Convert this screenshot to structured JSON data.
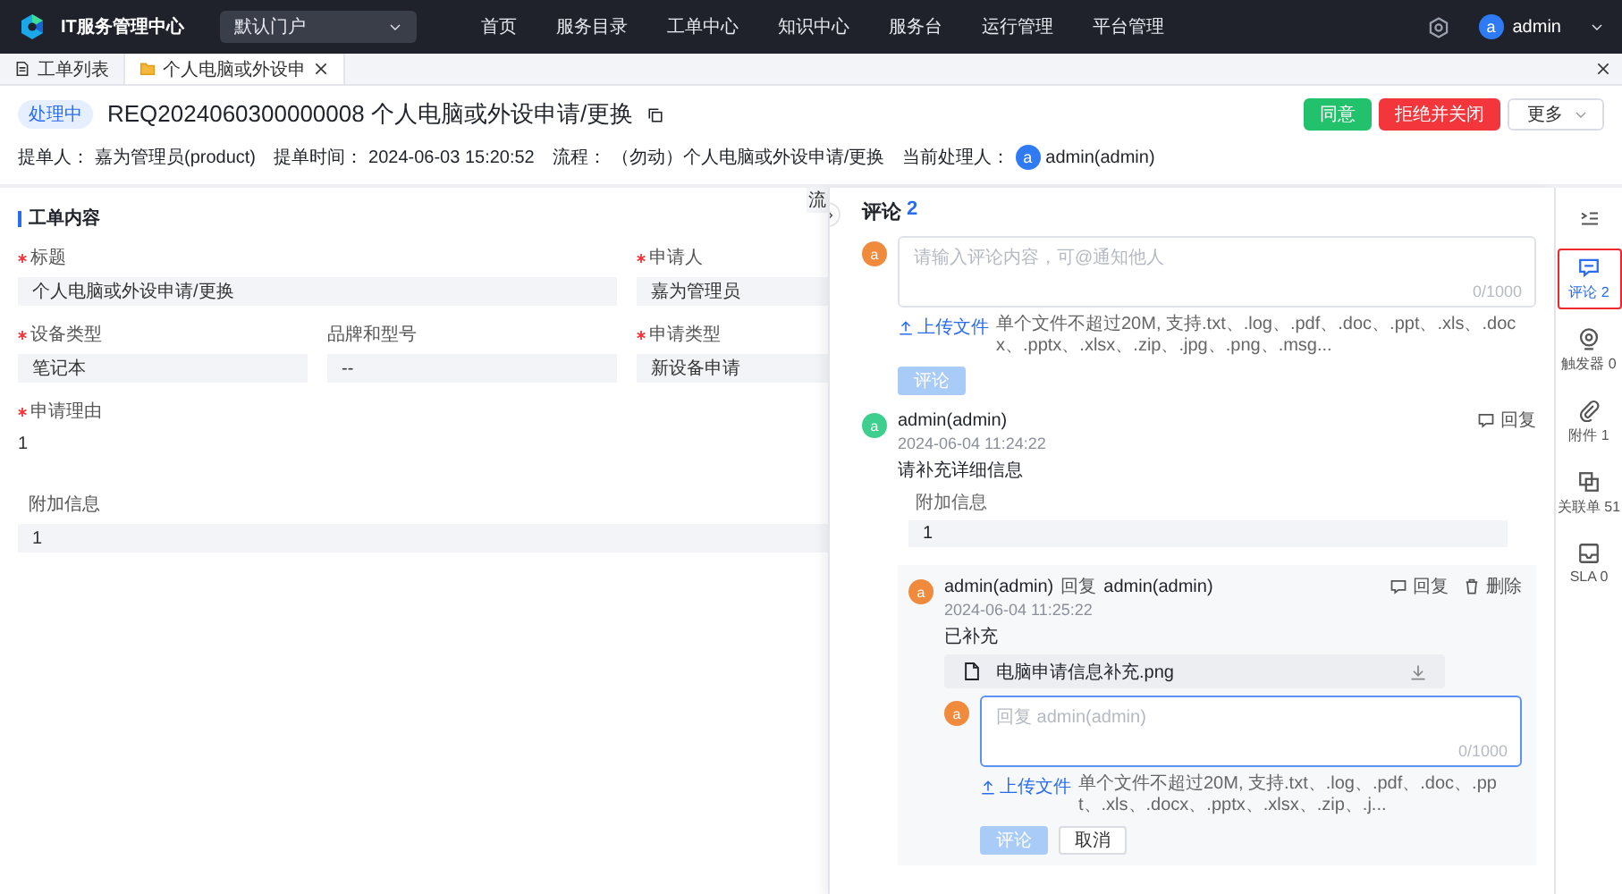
{
  "topbar": {
    "app_title": "IT服务管理中心",
    "portal_select": "默认门户",
    "menu": [
      "首页",
      "服务目录",
      "工单中心",
      "知识中心",
      "服务台",
      "运行管理",
      "平台管理"
    ],
    "user": {
      "avatar": "a",
      "name": "admin"
    }
  },
  "tabs": [
    {
      "label": "工单列表",
      "kind": "list",
      "selected": false,
      "closable": false
    },
    {
      "label": "个人电脑或外设申",
      "kind": "ticket",
      "selected": true,
      "closable": true
    }
  ],
  "ticket": {
    "status": "处理中",
    "title": "REQ2024060300000008 个人电脑或外设申请/更换",
    "actions": [
      {
        "label": "同意",
        "kind": "success"
      },
      {
        "label": "拒绝并关闭",
        "kind": "danger"
      },
      {
        "label": "更多",
        "kind": "dropdown"
      }
    ],
    "meta": [
      {
        "label": "提单人：",
        "value": "嘉为管理员(product)"
      },
      {
        "label": "提单时间：",
        "value": "2024-06-03 15:20:52"
      },
      {
        "label": "流程：",
        "value": "（勿动）个人电脑或外设申请/更换"
      },
      {
        "label": "当前处理人：",
        "value": "admin(admin)",
        "avatar": "a"
      }
    ]
  },
  "form": {
    "section_title": "工单内容",
    "side_tab_fragment": "流",
    "fields": [
      {
        "label": "标题",
        "required": true,
        "value": "个人电脑或外设申请/更换",
        "kind": "wide"
      },
      {
        "label": "申请人",
        "required": true,
        "value": "嘉为管理员",
        "kind": "box"
      },
      {
        "label": "设备类型",
        "required": true,
        "value": "笔记本",
        "kind": "box"
      },
      {
        "label": "品牌和型号",
        "required": false,
        "value": "--",
        "kind": "box"
      },
      {
        "label": "申请类型",
        "required": true,
        "value": "新设备申请",
        "kind": "box"
      },
      {
        "label": "申请理由",
        "required": true,
        "value": "1",
        "kind": "plain"
      },
      {
        "label": "附加信息",
        "required": false,
        "value": "1",
        "kind": "full"
      }
    ]
  },
  "comments_panel": {
    "title": "评论",
    "count": "2",
    "composer": {
      "avatar": "a",
      "placeholder": "请输入评论内容，可@通知他人",
      "counter": "0/1000",
      "upload_label": "上传文件",
      "upload_hint": "单个文件不超过20M, 支持.txt、.log、.pdf、.doc、.ppt、.xls、.docx、.pptx、.xlsx、.zip、.jpg、.png、.msg...",
      "submit": {
        "label": "评论",
        "disabled": true
      }
    },
    "comments": [
      {
        "avatar": "a",
        "color": "#3ecf8e",
        "author": "admin(admin)",
        "time": "2024-06-04 11:24:22",
        "text": "请补充详细信息",
        "actions": [
          {
            "kind": "reply",
            "label": "回复"
          }
        ],
        "extra": {
          "label": "附加信息",
          "value": "1"
        },
        "replies": [
          {
            "avatar": "a",
            "color": "#f08a3c",
            "author": "admin(admin)",
            "reply_word": "回复",
            "reply_to": "admin(admin)",
            "time": "2024-06-04 11:25:22",
            "text": "已补充",
            "actions": [
              {
                "kind": "reply",
                "label": "回复"
              },
              {
                "kind": "delete",
                "label": "删除"
              }
            ],
            "attachment": "电脑申请信息补充.png"
          }
        ],
        "reply_box": {
          "avatar": "a",
          "placeholder": "回复 admin(admin)",
          "counter": "0/1000",
          "upload_label": "上传文件",
          "upload_hint": "单个文件不超过20M, 支持.txt、.log、.pdf、.doc、.ppt、.xls、.docx、.pptx、.xlsx、.zip、.j...",
          "submit": {
            "label": "评论",
            "disabled": true
          },
          "cancel": "取消"
        }
      }
    ]
  },
  "rail": [
    {
      "kind": "collapse",
      "selected": false
    },
    {
      "kind": "comment",
      "label": "评论 2",
      "selected": true
    },
    {
      "kind": "trigger",
      "label": "触发器 0",
      "selected": false
    },
    {
      "kind": "attachment",
      "label": "附件 1",
      "selected": false
    },
    {
      "kind": "related",
      "label": "关联单 51",
      "selected": false
    },
    {
      "kind": "sla",
      "label": "SLA 0",
      "selected": false
    }
  ]
}
